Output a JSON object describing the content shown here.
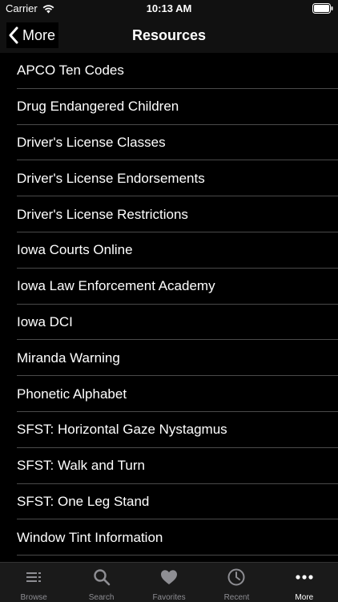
{
  "status_bar": {
    "carrier": "Carrier",
    "time": "10:13 AM"
  },
  "nav": {
    "back_label": "More",
    "title": "Resources"
  },
  "resources": [
    "APCO Ten Codes",
    "Drug Endangered Children",
    "Driver's License Classes",
    "Driver's License Endorsements",
    "Driver's License Restrictions",
    "Iowa Courts Online",
    "Iowa Law Enforcement Academy",
    "Iowa DCI",
    "Miranda Warning",
    "Phonetic Alphabet",
    "SFST: Horizontal Gaze Nystagmus",
    "SFST: Walk and Turn",
    "SFST: One Leg Stand",
    "Window Tint Information"
  ],
  "tabs": [
    {
      "label": "Browse",
      "icon": "list-icon"
    },
    {
      "label": "Search",
      "icon": "search-icon"
    },
    {
      "label": "Favorites",
      "icon": "heart-icon"
    },
    {
      "label": "Recent",
      "icon": "clock-icon"
    },
    {
      "label": "More",
      "icon": "ellipsis-icon"
    }
  ],
  "colors": {
    "background": "#000000",
    "tab_inactive": "#8e8e93",
    "tab_active": "#ffffff",
    "separator": "#4a4a4a"
  }
}
